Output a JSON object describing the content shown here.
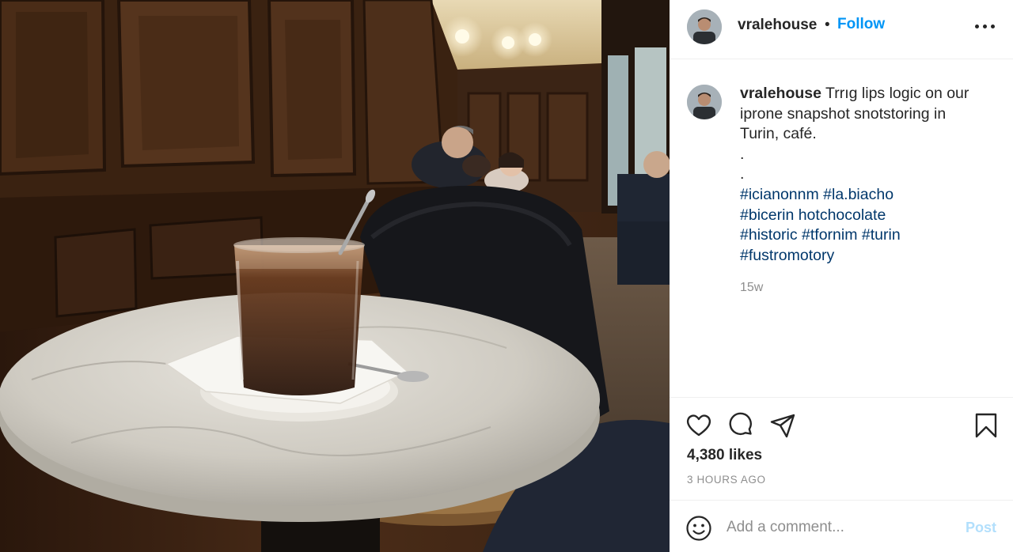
{
  "post": {
    "image_alt": "Glass of bicerin on a marble cafe table",
    "photo_icon": "cafe-photo"
  },
  "header": {
    "username": "vralehouse",
    "separator": "•",
    "follow_label": "Follow",
    "more_icon": "more-options-icon"
  },
  "caption": {
    "username": "vralehouse",
    "text_lines": [
      "Trrıg lips logic on our",
      "iprone snapshot snotstoring in",
      "Turin, café.",
      ".",
      "."
    ],
    "hashtag_lines": [
      "#icianonnm #la.biacho",
      "#bicerin hotchocolate",
      "#historic #tfornim #turin",
      "#fustromotory"
    ],
    "age": "15w"
  },
  "actions": {
    "like_icon": "heart-icon",
    "comment_icon": "comment-icon",
    "share_icon": "paper-plane-icon",
    "save_icon": "bookmark-icon",
    "likes_text": "4,380 likes",
    "posted_text": "3 HOURS AGO"
  },
  "comment_box": {
    "emoji_icon": "smiley-icon",
    "placeholder": "Add a comment...",
    "post_label": "Post"
  },
  "colors": {
    "follow": "#0095f6",
    "hashtag": "#00376b",
    "muted": "#8e8e8e",
    "post_disabled": "#b2dffc"
  }
}
